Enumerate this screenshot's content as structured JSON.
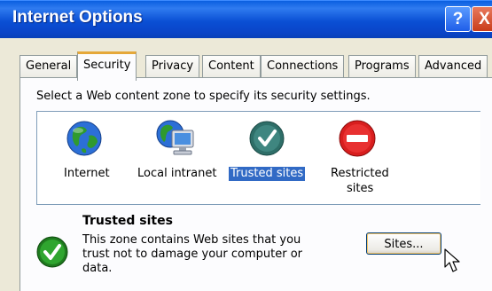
{
  "window": {
    "title": "Internet Options",
    "help_glyph": "?",
    "close_glyph": "X"
  },
  "tabs": [
    "General",
    "Security",
    "Privacy",
    "Content",
    "Connections",
    "Programs",
    "Advanced"
  ],
  "active_tab": "Security",
  "instruction": "Select a Web content zone to specify its security settings.",
  "zones": [
    {
      "label": "Internet",
      "icon": "globe-icon"
    },
    {
      "label": "Local intranet",
      "icon": "computer-globe-icon"
    },
    {
      "label": "Trusted sites",
      "icon": "checkmark-icon",
      "selected": true
    },
    {
      "label_line1": "Restricted",
      "label_line2": "sites",
      "icon": "no-entry-icon"
    }
  ],
  "details": {
    "title": "Trusted sites",
    "description": "This zone contains Web sites that you trust not to damage your computer or data.",
    "sites_button": "Sites..."
  },
  "colors": {
    "title_bar": "#0a4fd4",
    "selection": "#316ac5",
    "active_tab_accent": "#e5a83a"
  }
}
